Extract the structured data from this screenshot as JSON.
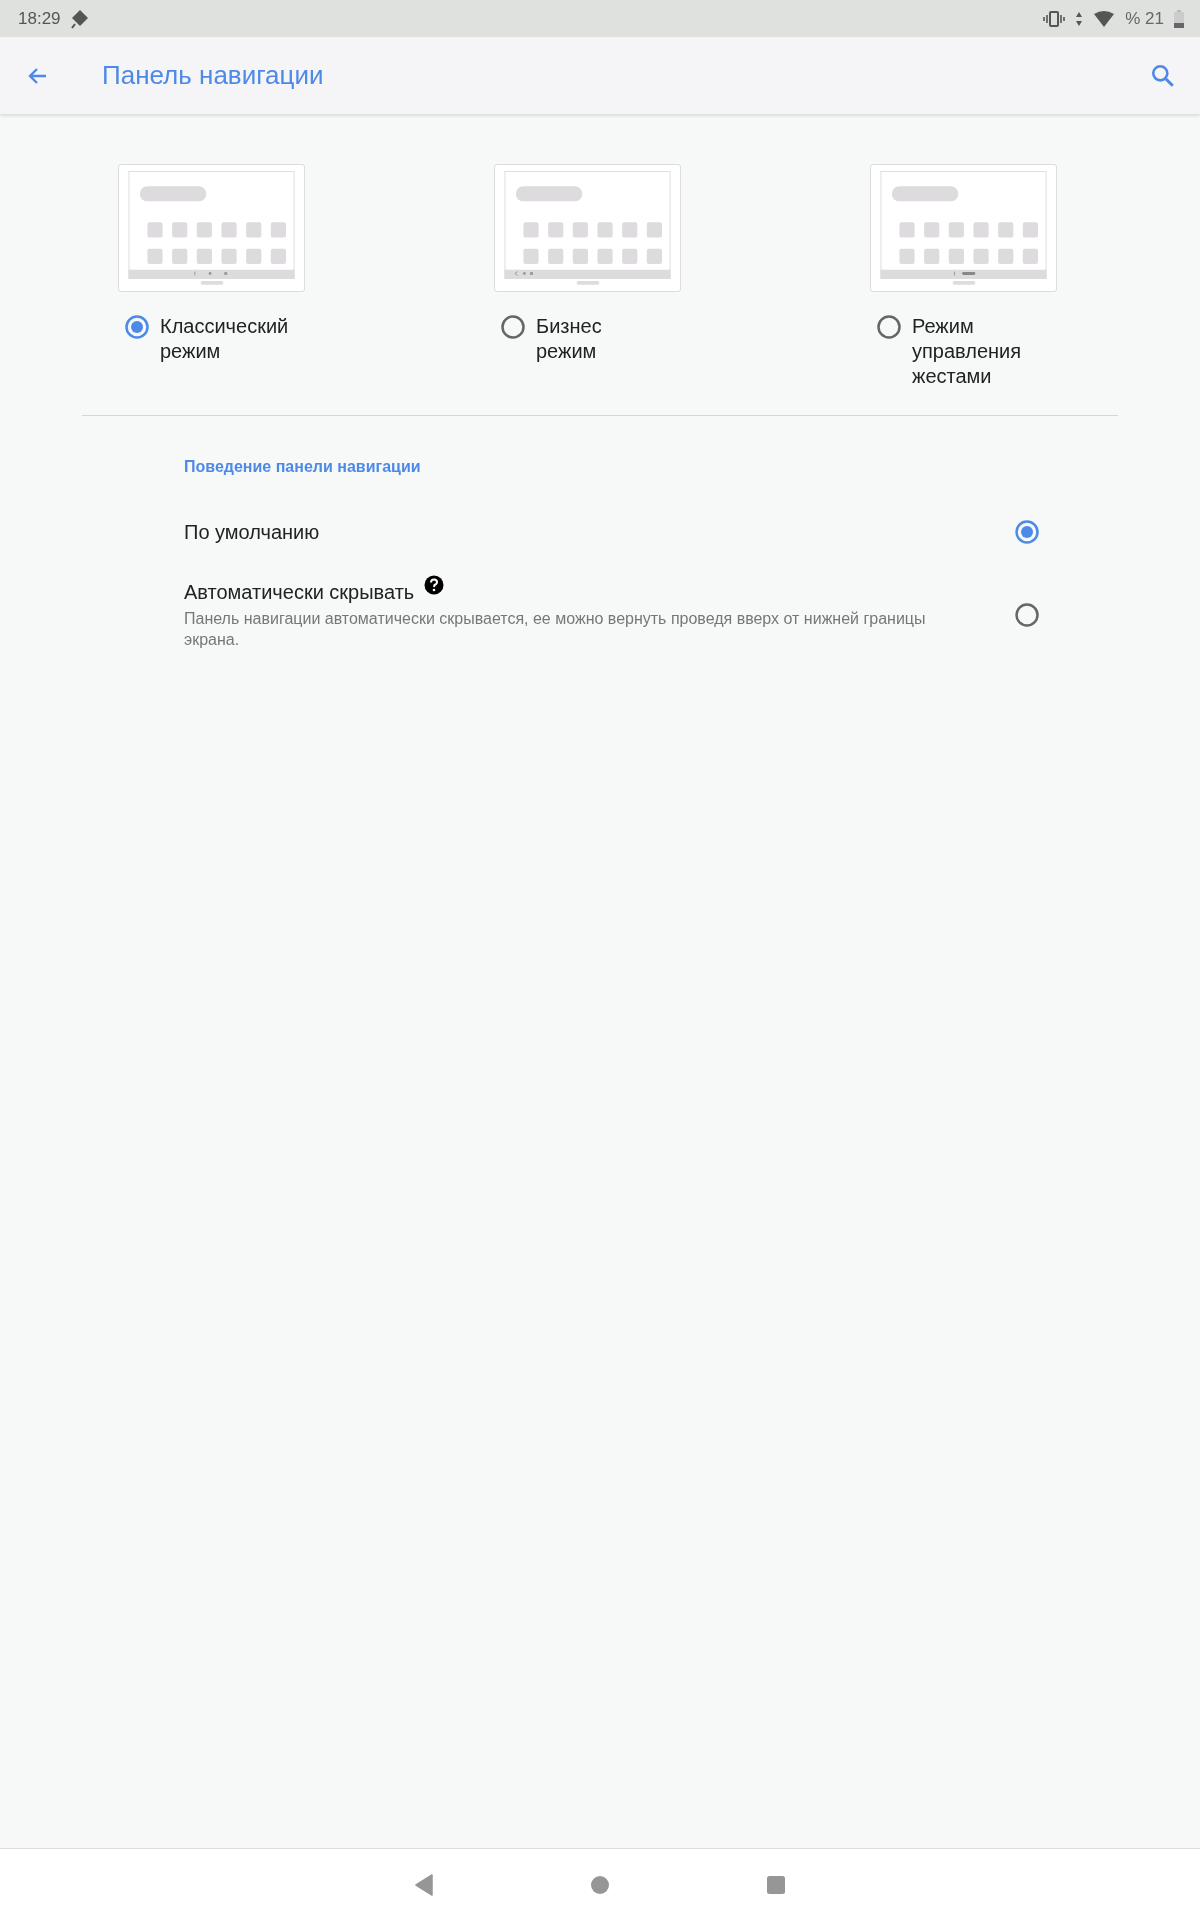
{
  "status_bar": {
    "time": "18:29",
    "battery": "% 21"
  },
  "toolbar": {
    "title": "Панель навигации"
  },
  "modes": [
    {
      "kind": "classic",
      "label": "Классический\nрежим",
      "selected": true
    },
    {
      "kind": "business",
      "label": "Бизнес\nрежим",
      "selected": false
    },
    {
      "kind": "gesture",
      "label": "Режим\nуправления\nжестами",
      "selected": false
    }
  ],
  "section": {
    "title": "Поведение панели навигации"
  },
  "options": [
    {
      "title": "По умолчанию",
      "help": false,
      "selected": true
    },
    {
      "title": "Автоматически скрывать",
      "help": true,
      "description": "Панель навигации автоматически скрывается, ее можно вернуть проведя вверх от нижней границы экрана.",
      "selected": false
    }
  ]
}
